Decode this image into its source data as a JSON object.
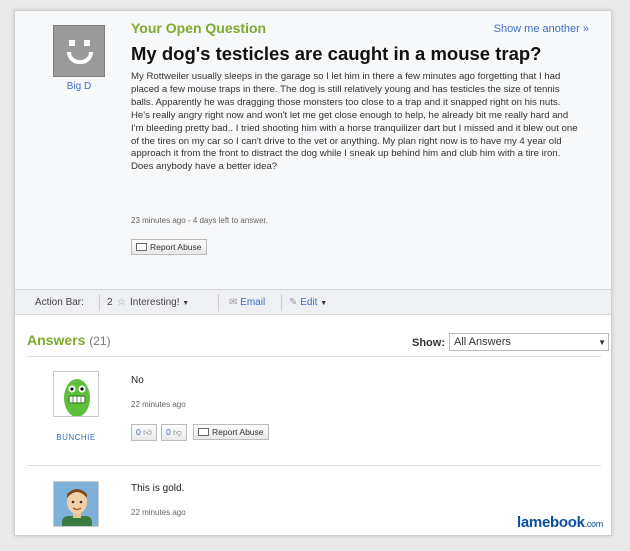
{
  "question": {
    "section_label": "Your Open Question",
    "show_another": "Show me another »",
    "asker_name": "Big D",
    "title": "My dog's testicles are caught in a mouse trap?",
    "body": "My Rottweiler usually sleeps in the garage so I let him in there a few minutes ago forgetting that I had placed a few mouse traps in there. The dog is still relatively young and has testicles the size of tennis balls. Apparently he was dragging those monsters too close to a trap and it snapped right on his nuts. He's really angry right now and won't let me get close enough to help, he already bit me really hard and I'm bleeding pretty bad.. I tried shooting him with a horse tranquilizer dart but I missed and it blew out one of the tires on my car so I can't drive to the vet or anything. My plan right now is to have my 4 year old approach it from the front to distract the dog while I sneak up behind him and club him with a tire iron. Does anybody have a better idea?",
    "meta": "23 minutes ago - 4 days left to answer.",
    "report_label": "Report Abuse"
  },
  "action_bar": {
    "label": "Action Bar:",
    "star_count": "2",
    "interesting": "Interesting!",
    "email": "Email",
    "edit": "Edit"
  },
  "answers": {
    "heading": "Answers",
    "count": "(21)",
    "show_label": "Show:",
    "show_value": "All Answers",
    "items": [
      {
        "author": "BUNCHIE",
        "text": "No",
        "meta": "22 minutes ago",
        "thumbs_up": "0",
        "thumbs_down": "0",
        "report_label": "Report Abuse"
      },
      {
        "text": "This is gold.",
        "meta": "22 minutes ago"
      }
    ]
  },
  "watermark": {
    "brand": "lamebook",
    "domain": ".com"
  },
  "colors": {
    "accent_green": "#7cab2e",
    "link_blue": "#3d6ec2",
    "brand_blue": "#0a4ea0"
  }
}
